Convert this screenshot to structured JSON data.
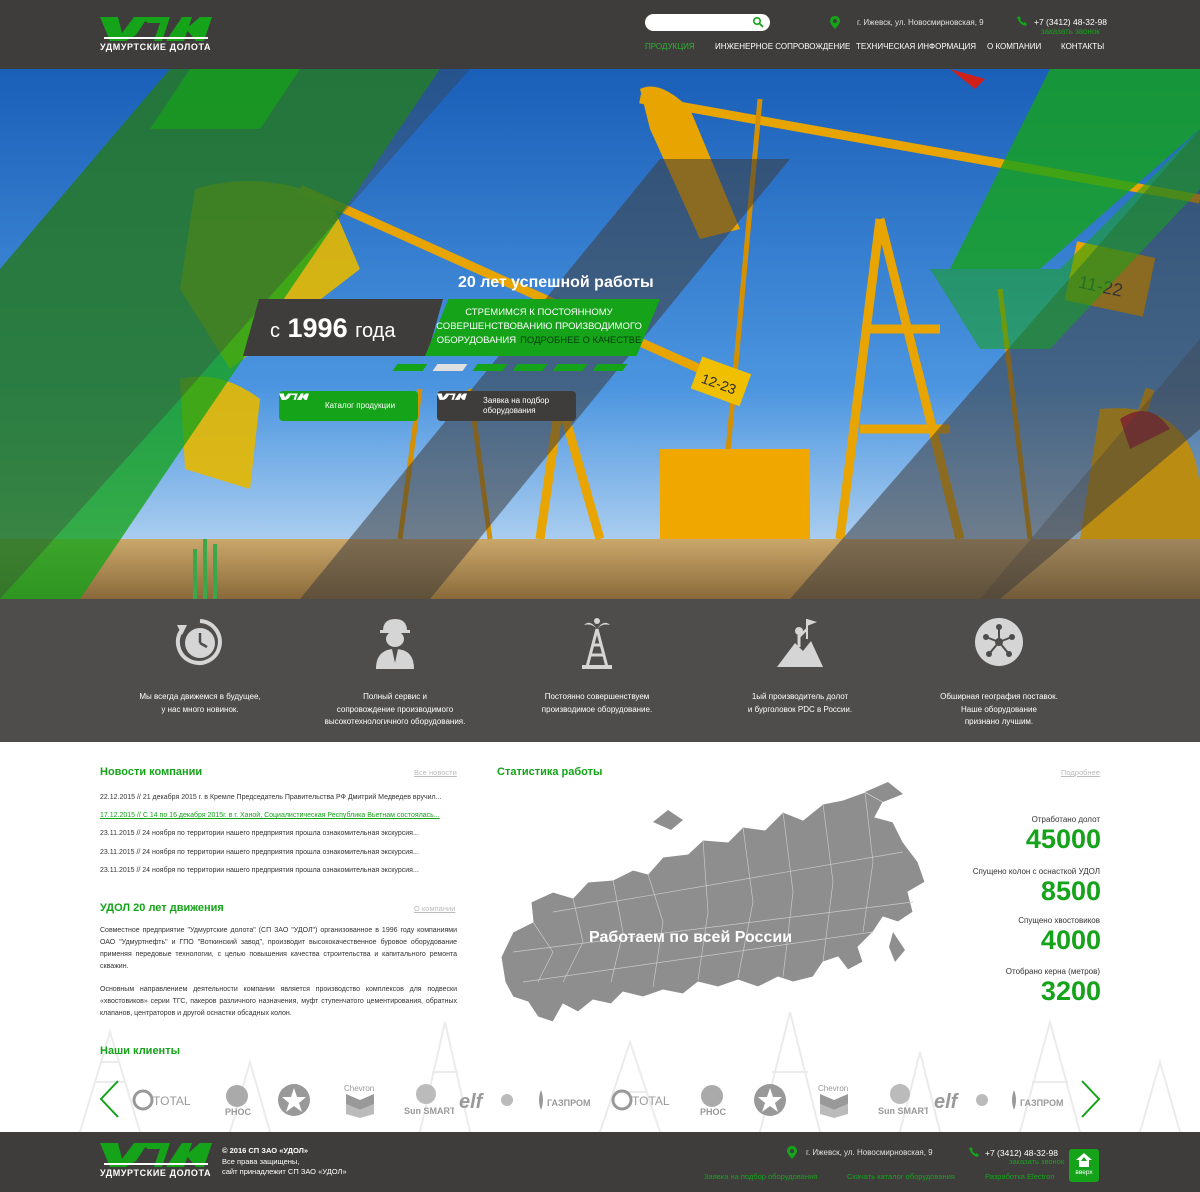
{
  "header": {
    "logo_text": "УДМУРТСКИЕ ДОЛОТА",
    "search_placeholder": "",
    "address": "г. Ижевск, ул. Новосмирновская, 9",
    "phone": "+7 (3412) 48-32-98",
    "callback": "заказать звонок",
    "nav": [
      {
        "label": "продукция",
        "active": true
      },
      {
        "label": "инженерное сопровождение",
        "active": false
      },
      {
        "label": "техническая информация",
        "active": false
      },
      {
        "label": "о компании",
        "active": false
      },
      {
        "label": "контакты",
        "active": false
      }
    ]
  },
  "hero": {
    "title": "20 лет успешной работы",
    "since_prefix": "с",
    "since_year": "1996",
    "since_suffix": "года",
    "slogan": "стремимся к постоянному совершенствованию производимого оборудования",
    "more": "подробнее о качестве",
    "slide_count": 6,
    "active_slide": 1,
    "catalog_btn": "Каталог продукции",
    "request_btn": "Заявка на подбор оборудования",
    "rig_labels": [
      "11-22",
      "12-23"
    ]
  },
  "features": [
    {
      "icon": "clock-arrow-icon",
      "text": "Мы всегда движемся в будущее,\nу нас много новинок."
    },
    {
      "icon": "engineer-icon",
      "text": "Полный сервис и\nсопровождение производимого\nвысокотехнологичного оборудования."
    },
    {
      "icon": "oil-rig-icon",
      "text": "Постоянно совершенствуем\nпроизводимое оборудование."
    },
    {
      "icon": "summit-flag-icon",
      "text": "1ый производитель долот\nи бурголовок PDC в России."
    },
    {
      "icon": "network-icon",
      "text": "Обширная география поставок.\nНаше оборудование\nпризнано лучшим."
    }
  ],
  "news": {
    "title": "Новости компании",
    "all_link": "Все новости",
    "items": [
      {
        "text": "22.12.2015 // 21 декабря 2015 г. в Кремле Председатель Правительства РФ Дмитрий Медведев вручил...",
        "highlight": false
      },
      {
        "text": "17.12.2015 // С 14 по 16 декабря 2015г. в г. Ханой, Социалистическая Республика Вьетнам состоялась...",
        "highlight": true
      },
      {
        "text": "23.11.2015 // 24 ноября по территории нашего предприятия прошла ознакомительная экскурсия...",
        "highlight": false
      },
      {
        "text": "23.11.2015 // 24 ноября по территории нашего предприятия прошла ознакомительная экскурсия...",
        "highlight": false
      },
      {
        "text": "23.11.2015 // 24 ноября по территории нашего предприятия прошла ознакомительная экскурсия...",
        "highlight": false
      }
    ]
  },
  "about": {
    "title": "УДОЛ 20 лет движения",
    "link": "О компании",
    "p1": "Совместное предприятие \"Удмуртские долота\" (СП ЗАО \"УДОЛ\") организованное в 1996 году компаниями ОАО \"Удмуртнефть\" и ГПО \"Воткинский завод\", производит высококачественное буровое оборудование применяя передовые технологии, с целью повышения качества строительства и капитального ремонта скважин.",
    "p2": "Основным направлением деятельности компании является производство комплексов для подвески «хвостовиков» серии ТГС, пакеров различного назначения, муфт ступенчатого цементирования, обратных клапанов, центраторов и другой оснастки обсадных колон."
  },
  "stats": {
    "title": "Статистика работы",
    "link": "Подробнее",
    "map_label": "Работаем по всей России",
    "items": [
      {
        "label": "Отработано долот",
        "value": "45000"
      },
      {
        "label": "Спущено колон с оснасткой УДОЛ",
        "value": "8500"
      },
      {
        "label": "Спущено хвостовиков",
        "value": "4000"
      },
      {
        "label": "Отобрано керна (метров)",
        "value": "3200"
      }
    ]
  },
  "clients": {
    "title": "Наши клиенты",
    "logos": [
      "TOTAL",
      "PHOC",
      "TEXACO",
      "Chevron",
      "Sun SMART",
      "elf",
      "ГАЗПРОМ",
      "TOTAL",
      "PHOC",
      "TEXACO",
      "Chevron",
      "Sun SMART",
      "elf",
      "ГАЗПРОМ"
    ]
  },
  "footer": {
    "copyright": "© 2016 СП ЗАО «УДОЛ»",
    "rights": "Все права защищены,",
    "owner": "сайт принадлежит СП ЗАО «УДОЛ»",
    "address": "г. Ижевск, ул. Новосмирновская, 9",
    "phone": "+7 (3412) 48-32-98",
    "callback": "заказать звонок",
    "links": [
      "Заявка на подбор оборудования",
      "Скачать каталог оборудования",
      "Разработка Electron"
    ],
    "top_label": "вверх"
  },
  "colors": {
    "brand_green": "#15a31a",
    "dark": "#3e3d3c",
    "features_bg": "#4e4d4c",
    "map_gray": "#8e8e8e"
  }
}
